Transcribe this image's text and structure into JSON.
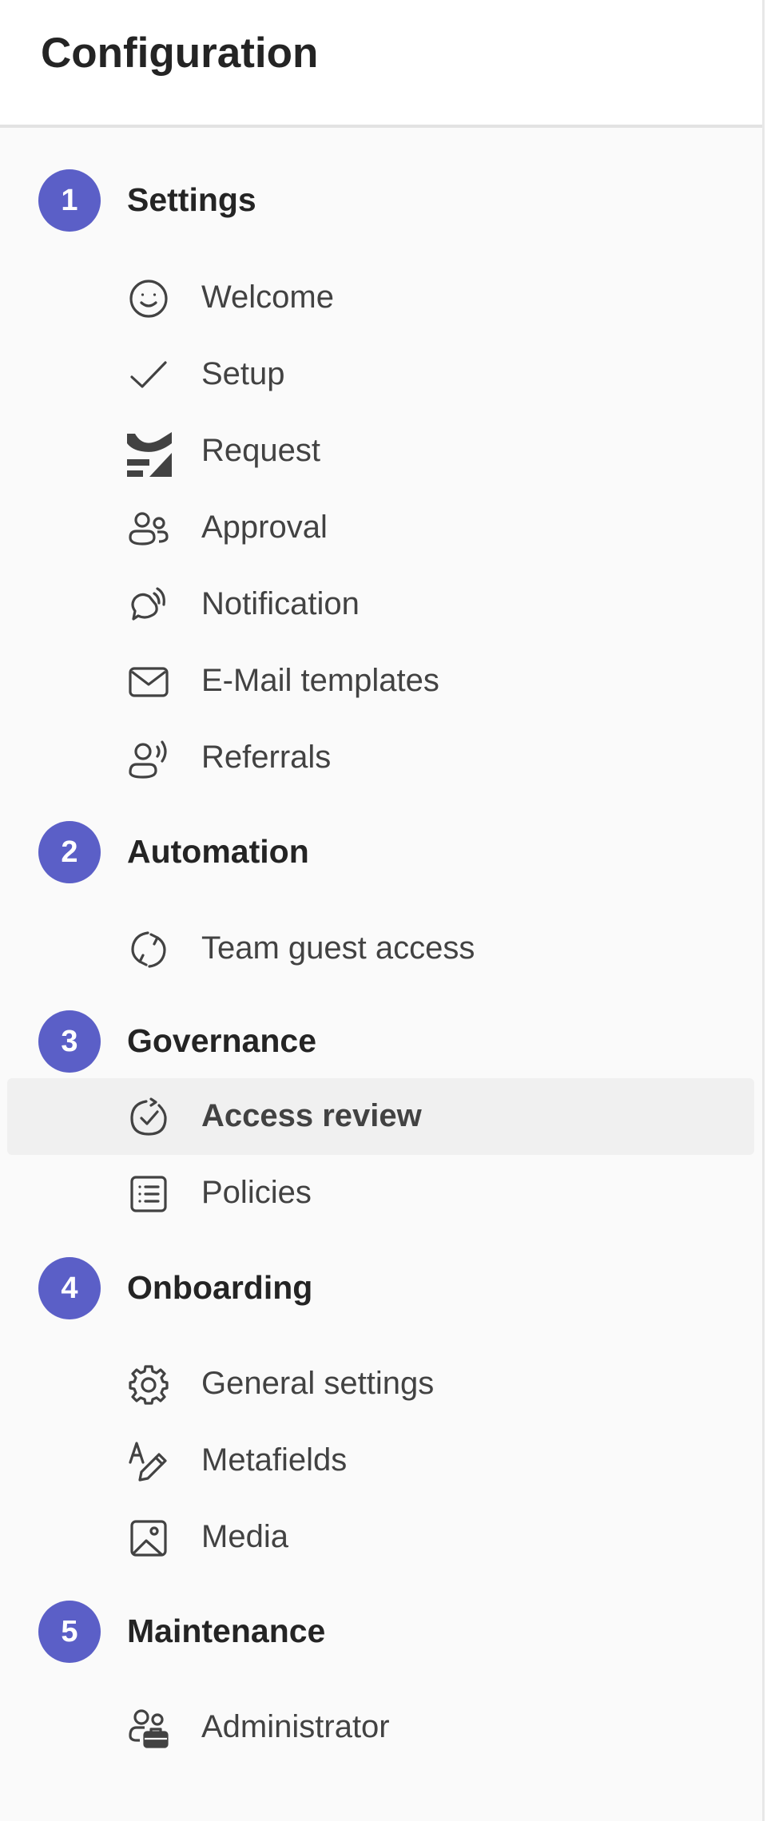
{
  "header": {
    "title": "Configuration"
  },
  "colors": {
    "accent": "#5b5fc7",
    "active_row": "#f0f0f0",
    "text": "#424242"
  },
  "sections": [
    {
      "number": "1",
      "title": "Settings",
      "items": [
        {
          "label": "Welcome",
          "icon": "smiley-icon"
        },
        {
          "label": "Setup",
          "icon": "checkmark-icon"
        },
        {
          "label": "Request",
          "icon": "brand-logo-icon"
        },
        {
          "label": "Approval",
          "icon": "people-icon"
        },
        {
          "label": "Notification",
          "icon": "chat-bell-icon"
        },
        {
          "label": "E-Mail templates",
          "icon": "mail-icon"
        },
        {
          "label": "Referrals",
          "icon": "person-voice-icon"
        }
      ]
    },
    {
      "number": "2",
      "title": "Automation",
      "items": [
        {
          "label": "Team guest access",
          "icon": "sync-icon"
        }
      ]
    },
    {
      "number": "3",
      "title": "Governance",
      "items": [
        {
          "label": "Access review",
          "icon": "circle-check-icon",
          "active": true
        },
        {
          "label": "Policies",
          "icon": "list-icon"
        }
      ]
    },
    {
      "number": "4",
      "title": "Onboarding",
      "items": [
        {
          "label": "General settings",
          "icon": "gear-icon"
        },
        {
          "label": "Metafields",
          "icon": "text-edit-icon"
        },
        {
          "label": "Media",
          "icon": "image-icon"
        }
      ]
    },
    {
      "number": "5",
      "title": "Maintenance",
      "items": [
        {
          "label": "Administrator",
          "icon": "people-toolbox-icon"
        }
      ]
    }
  ]
}
